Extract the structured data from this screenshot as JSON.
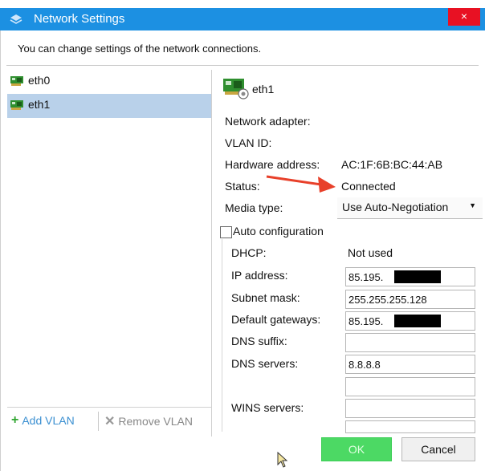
{
  "window": {
    "title": "Network Settings",
    "close_glyph": "×"
  },
  "subtitle": "You can change settings of the network connections.",
  "connections": [
    {
      "label": "eth0",
      "selected": false
    },
    {
      "label": "eth1",
      "selected": true
    }
  ],
  "actions": {
    "add_vlan": "Add VLAN",
    "remove_vlan": "Remove VLAN",
    "add_icon": "+",
    "remove_icon": "✕"
  },
  "detail": {
    "name": "eth1",
    "network_adapter_label": "Network adapter:",
    "vlan_id_label": "VLAN ID:",
    "hardware_address_label": "Hardware address:",
    "hardware_address_value": "AC:1F:6B:BC:44:AB",
    "status_label": "Status:",
    "status_value": "Connected",
    "media_type_label": "Media type:",
    "media_type_value": "Use Auto-Negotiation",
    "auto_config_label": "Auto configuration",
    "dhcp_label": "DHCP:",
    "dhcp_value": "Not used",
    "ip_label": "IP address:",
    "ip_value": "85.195.",
    "subnet_label": "Subnet mask:",
    "subnet_value": "255.255.255.128",
    "gateway_label": "Default gateways:",
    "gateway_value": "85.195.",
    "dns_suffix_label": "DNS suffix:",
    "dns_suffix_value": "",
    "dns_servers_label": "DNS servers:",
    "dns_server_1": "8.8.8.8",
    "dns_server_2": "",
    "wins_label": "WINS servers:",
    "wins_1": "",
    "wins_2": ""
  },
  "buttons": {
    "ok": "OK",
    "cancel": "Cancel"
  },
  "colors": {
    "titlebar": "#1c90e2",
    "ok": "#4cd964",
    "selection": "#b9d1ea",
    "arrow": "#e8402a"
  }
}
